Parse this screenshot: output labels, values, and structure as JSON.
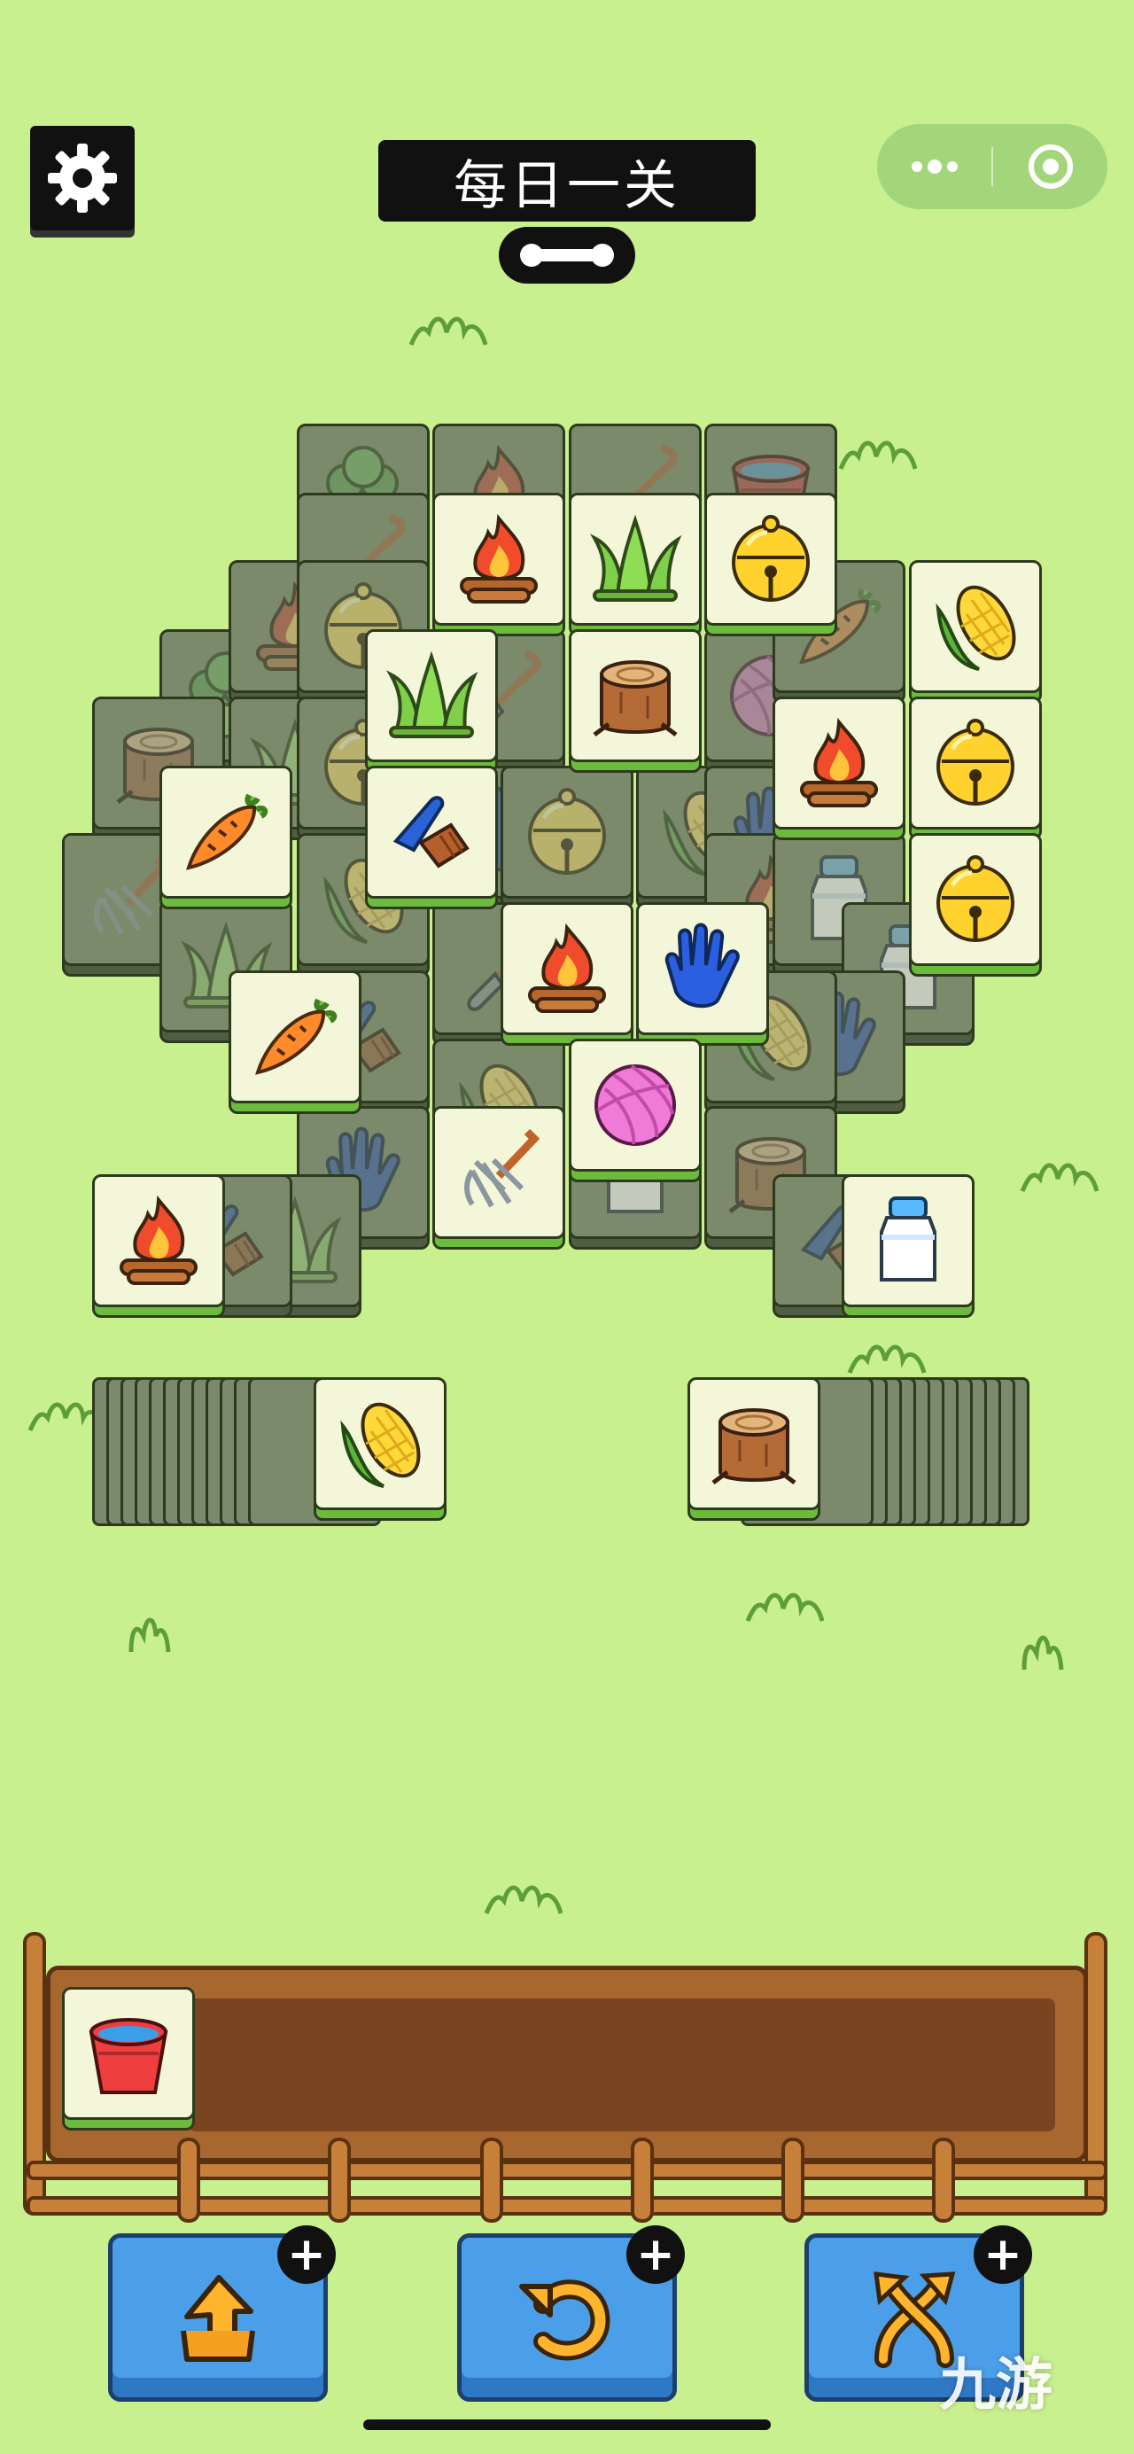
{
  "header": {
    "title": "每日一关",
    "settings_icon": "gear-icon",
    "progress_icon": "bone-icon",
    "capsule": {
      "more_icon": "more-dots-icon",
      "close_icon": "target-circle-icon"
    }
  },
  "board": {
    "top_tiles": [
      "broccoli",
      "campfire",
      "shovel",
      "water-bucket",
      "shovel",
      "campfire",
      "grass",
      "bell",
      "campfire",
      "bell",
      "carrot",
      "broccoli",
      "grass",
      "shovel",
      "tree-stump",
      "yarn-ball",
      "corn",
      "tree-stump",
      "carrot",
      "brush",
      "corn",
      "campfire",
      "bell",
      "pitchfork",
      "campfire",
      "bell",
      "carrot",
      "campfire",
      "glove",
      "glove",
      "pitchfork",
      "yarn-ball",
      "tree-stump",
      "campfire",
      "grass",
      "brush",
      "milk-jar"
    ]
  },
  "stacks": {
    "left_top": "corn",
    "right_top": "tree-stump"
  },
  "tray": {
    "slots": [
      "water-bucket"
    ]
  },
  "toolbar": [
    {
      "name": "remove-tool",
      "icon": "arrow-up-icon"
    },
    {
      "name": "undo-tool",
      "icon": "undo-icon"
    },
    {
      "name": "shuffle-tool",
      "icon": "shuffle-icon"
    }
  ],
  "plus_label": "+",
  "watermark": "九游",
  "colors": {
    "background": "#c8f08e",
    "tile_face": "#f3f6d8",
    "tile_base": "#6cbb3c",
    "button_blue": "#4b9ee8"
  }
}
